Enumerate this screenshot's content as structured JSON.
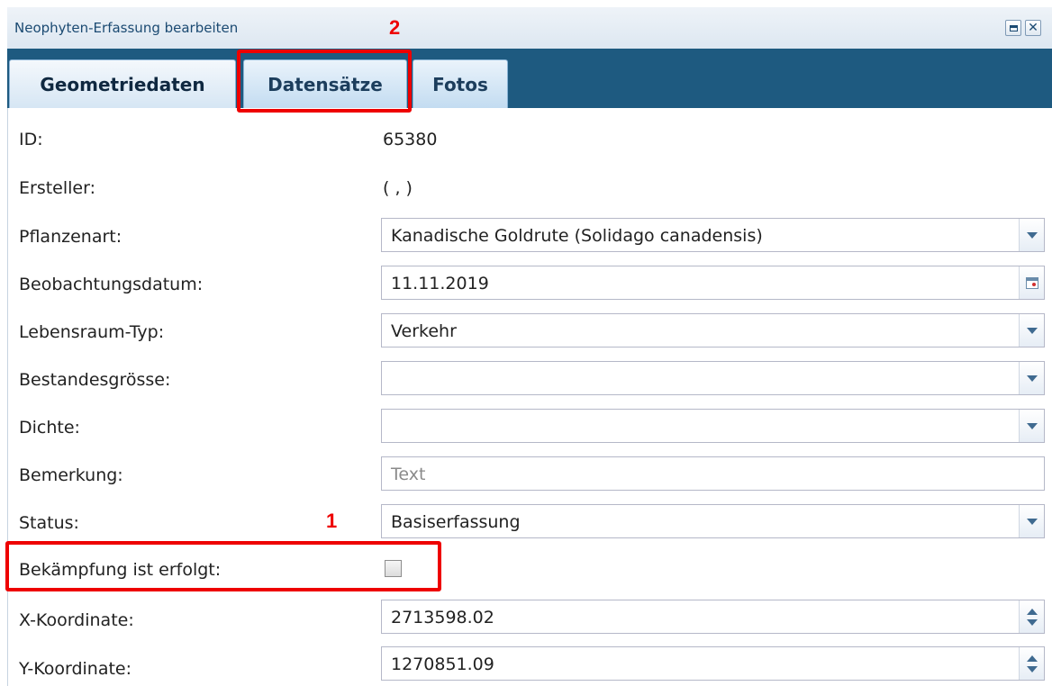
{
  "window": {
    "title": "Neophyten-Erfassung bearbeiten",
    "maximize_icon": "maximize-icon",
    "close_icon": "close-icon",
    "close_glyph": "✕"
  },
  "tabs": [
    {
      "label": "Geometriedaten",
      "active": true
    },
    {
      "label": "Datensätze",
      "active": false
    },
    {
      "label": "Fotos",
      "active": false
    }
  ],
  "form": {
    "id": {
      "label": "ID:",
      "value": "65380"
    },
    "ersteller": {
      "label": "Ersteller:",
      "value": "( , )"
    },
    "pflanzenart": {
      "label": "Pflanzenart:",
      "value": "Kanadische Goldrute (Solidago canadensis)"
    },
    "beobachtungsdatum": {
      "label": "Beobachtungsdatum:",
      "value": "11.11.2019"
    },
    "lebensraum": {
      "label": "Lebensraum-Typ:",
      "value": "Verkehr"
    },
    "bestandesgroesse": {
      "label": "Bestandesgrösse:",
      "value": ""
    },
    "dichte": {
      "label": "Dichte:",
      "value": ""
    },
    "bemerkung": {
      "label": "Bemerkung:",
      "value": "",
      "placeholder": "Text"
    },
    "status": {
      "label": "Status:",
      "value": "Basiserfassung"
    },
    "bekaempfung": {
      "label": "Bekämpfung ist erfolgt:",
      "checked": false
    },
    "x_koordinate": {
      "label": "X-Koordinate:",
      "value": "2713598.02"
    },
    "y_koordinate": {
      "label": "Y-Koordinate:",
      "value": "1270851.09"
    }
  },
  "annotations": {
    "marker_1": "1",
    "marker_2": "2",
    "highlight_color": "#ee0000"
  },
  "colors": {
    "tabbar_bg": "#1e5a80",
    "title_text": "#1b4a72"
  }
}
